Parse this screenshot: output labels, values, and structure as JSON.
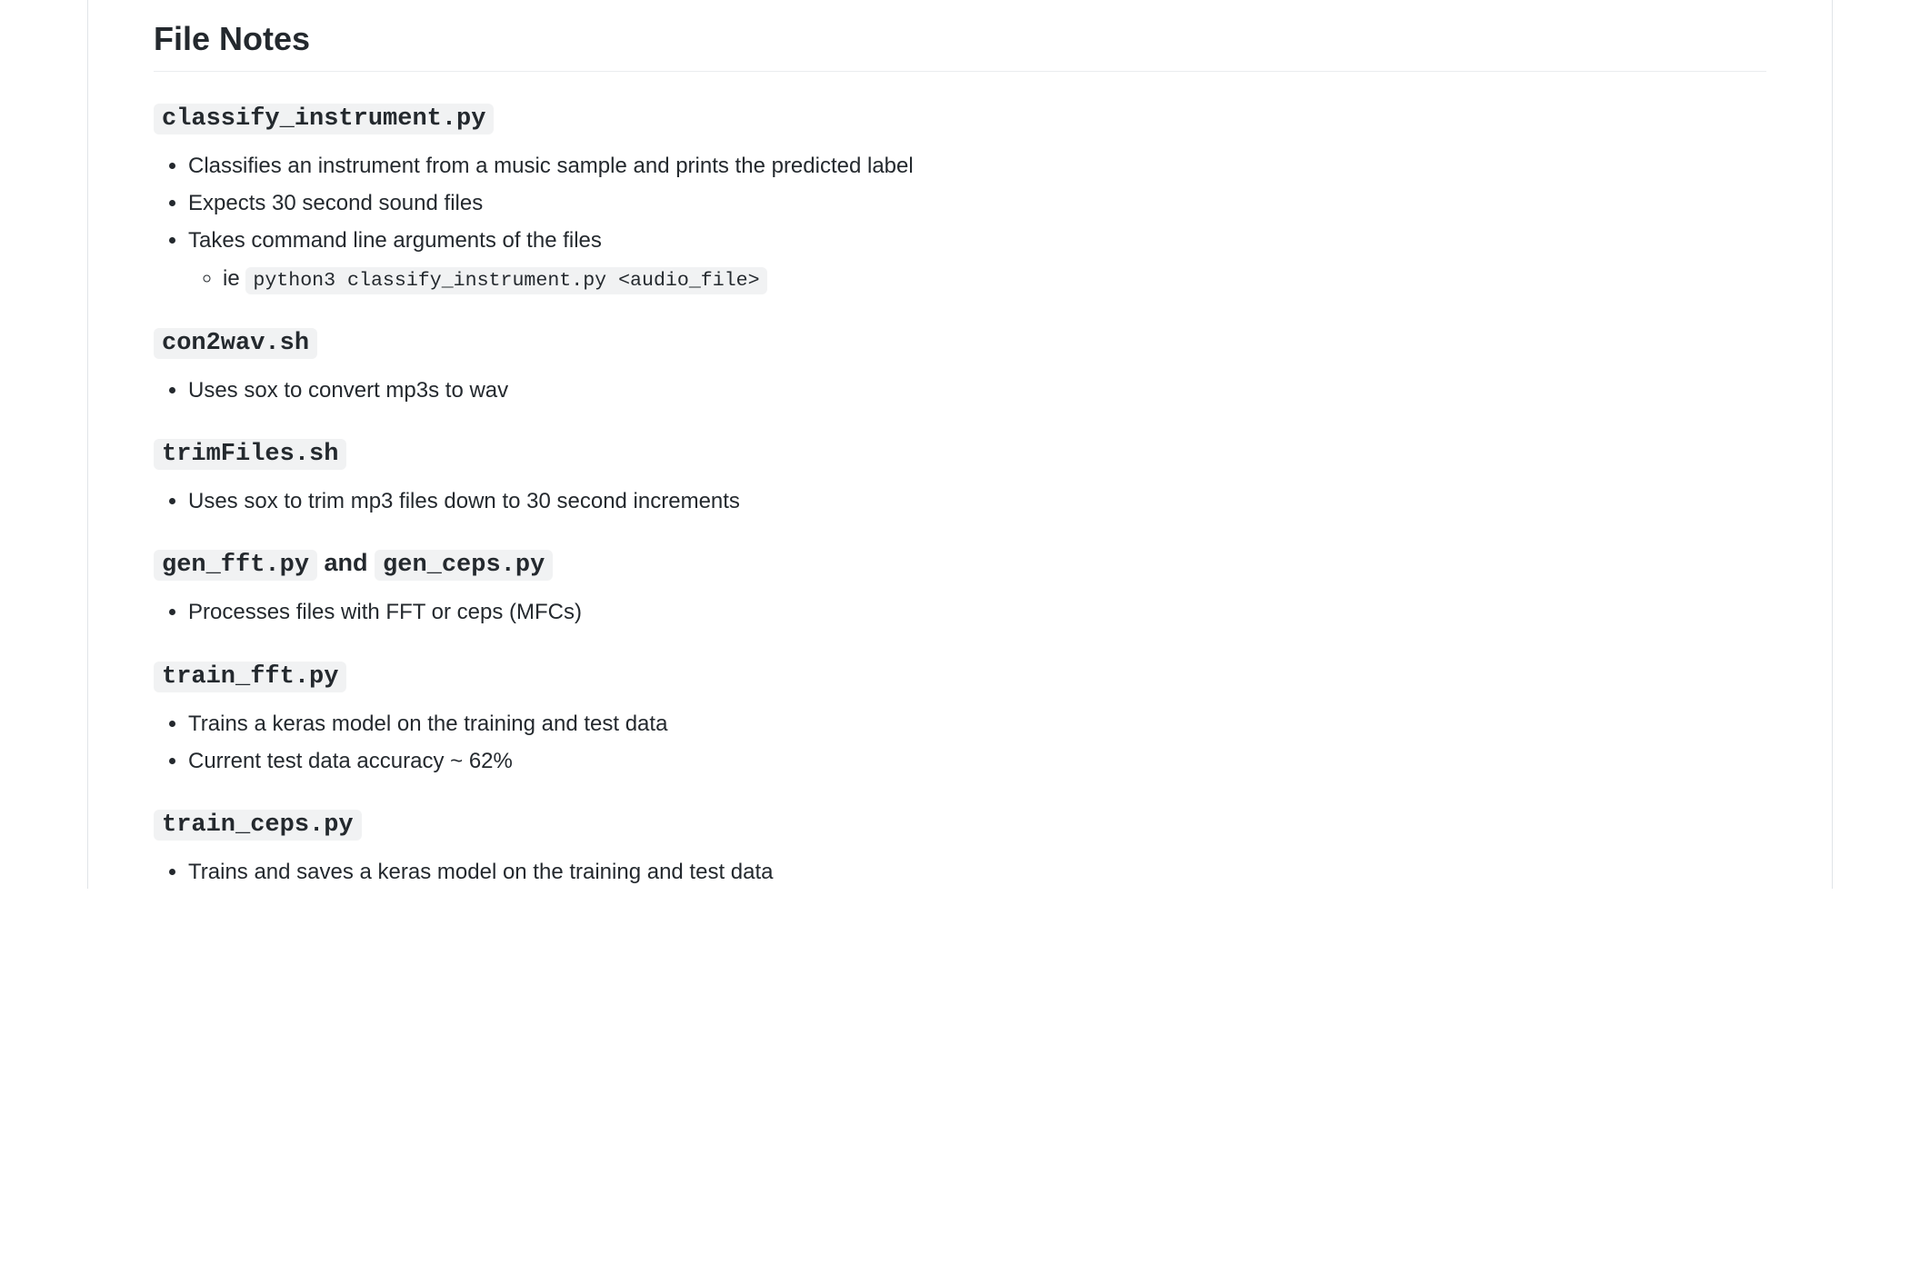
{
  "sectionTitle": "File Notes",
  "files": [
    {
      "name": "classify_instrument.py",
      "bullets": [
        "Classifies an instrument from a music sample and prints the predicted label",
        "Expects 30 second sound files",
        "Takes command line arguments of the files"
      ],
      "subPrefix": "ie ",
      "subCode": "python3 classify_instrument.py <audio_file>"
    },
    {
      "name": "con2wav.sh",
      "bullets": [
        "Uses sox to convert mp3s to wav"
      ]
    },
    {
      "name": "trimFiles.sh",
      "bullets": [
        "Uses sox to trim mp3 files down to 30 second increments"
      ]
    },
    {
      "name": "gen_fft.py",
      "name2": "gen_ceps.py",
      "joiner": " and ",
      "bullets": [
        "Processes files with FFT or ceps (MFCs)"
      ]
    },
    {
      "name": "train_fft.py",
      "bullets": [
        "Trains a keras model on the training and test data",
        "Current test data accuracy ~ 62%"
      ]
    },
    {
      "name": "train_ceps.py",
      "bullets": [
        "Trains and saves a keras model on the training and test data"
      ]
    }
  ]
}
